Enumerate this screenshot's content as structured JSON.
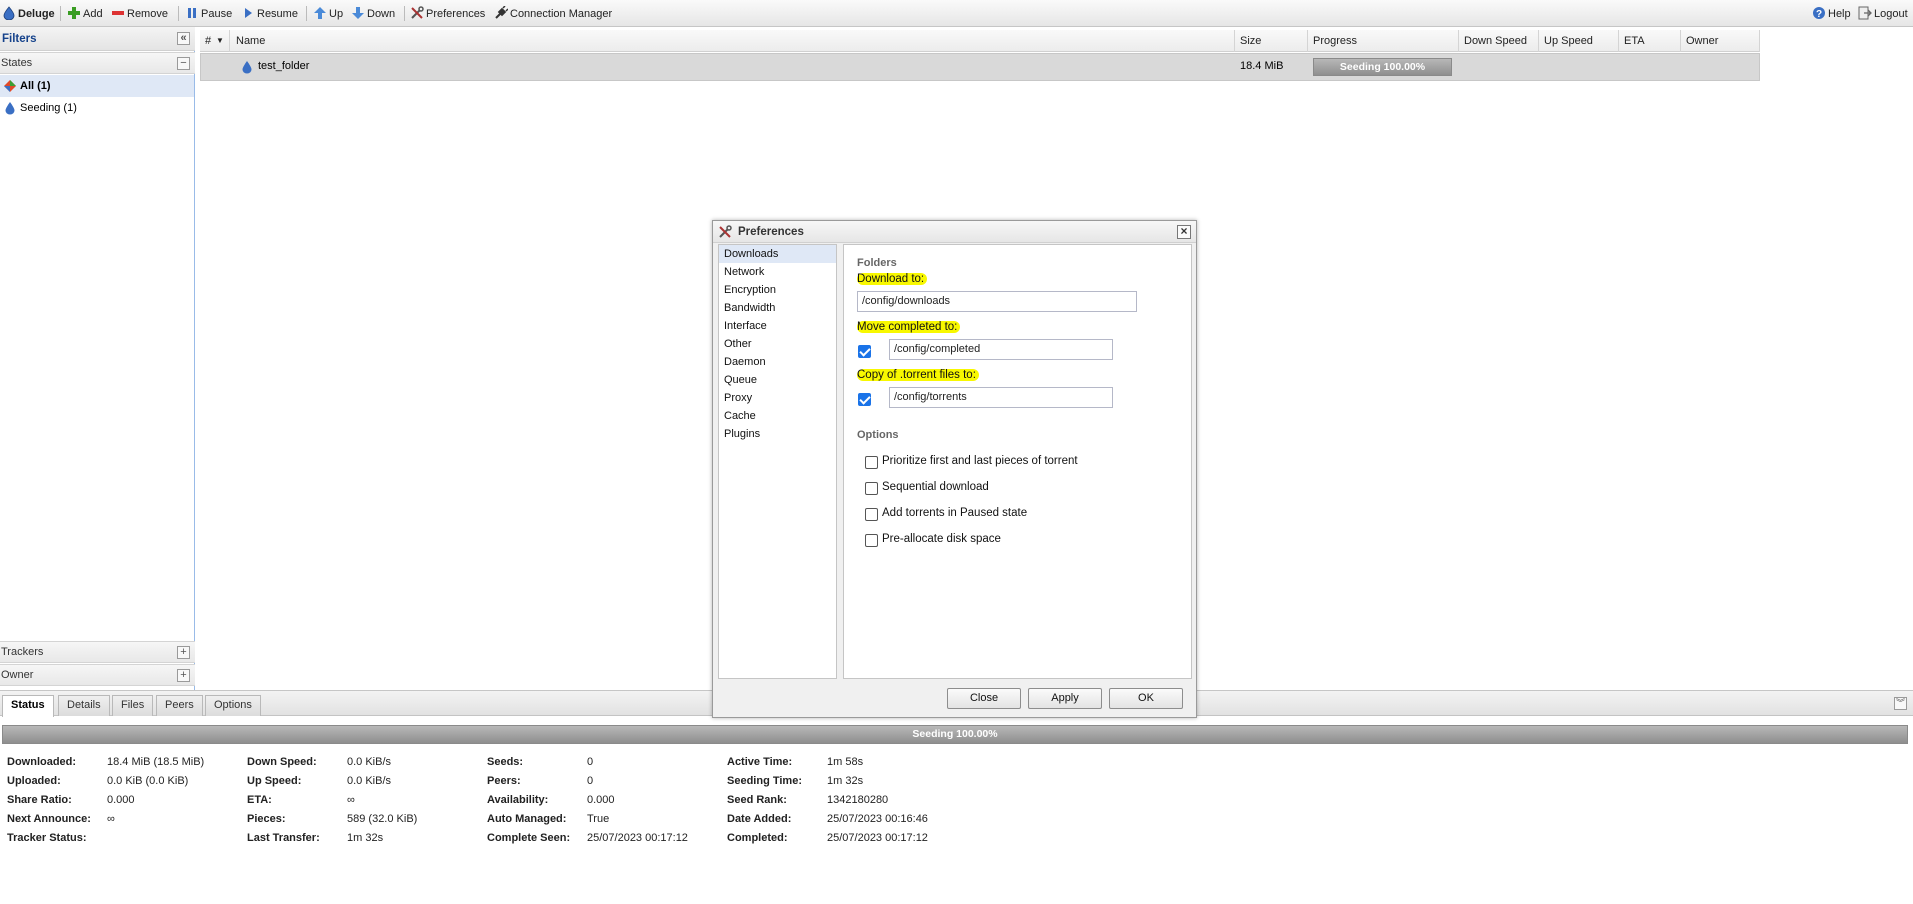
{
  "toolbar": {
    "app_title": "Deluge",
    "add": "Add",
    "remove": "Remove",
    "pause": "Pause",
    "resume": "Resume",
    "up": "Up",
    "down": "Down",
    "preferences": "Preferences",
    "connection_manager": "Connection Manager",
    "help": "Help",
    "logout": "Logout"
  },
  "filters": {
    "title": "Filters",
    "states_header": "States",
    "states": [
      {
        "label": "All (1)",
        "selected": true,
        "icon": "all-icon"
      },
      {
        "label": "Seeding (1)",
        "selected": false,
        "icon": "seeding-icon"
      }
    ],
    "trackers_header": "Trackers",
    "owner_header": "Owner"
  },
  "grid": {
    "columns": {
      "num": "#",
      "name": "Name",
      "size": "Size",
      "progress": "Progress",
      "down_speed": "Down Speed",
      "up_speed": "Up Speed",
      "eta": "ETA",
      "owner": "Owner"
    },
    "rows": [
      {
        "name": "test_folder",
        "size": "18.4 MiB",
        "progress_text": "Seeding 100.00%",
        "progress": 1.0
      }
    ]
  },
  "details": {
    "tabs": [
      "Status",
      "Details",
      "Files",
      "Peers",
      "Options"
    ],
    "active_tab": "Status",
    "progress_text": "Seeding 100.00%",
    "stats": {
      "downloaded_label": "Downloaded:",
      "downloaded": "18.4 MiB (18.5 MiB)",
      "uploaded_label": "Uploaded:",
      "uploaded": "0.0 KiB (0.0 KiB)",
      "share_ratio_label": "Share Ratio:",
      "share_ratio": "0.000",
      "next_announce_label": "Next Announce:",
      "next_announce": "∞",
      "tracker_status_label": "Tracker Status:",
      "tracker_status": "",
      "down_speed_label": "Down Speed:",
      "down_speed": "0.0 KiB/s",
      "up_speed_label": "Up Speed:",
      "up_speed": "0.0 KiB/s",
      "eta_label": "ETA:",
      "eta": "∞",
      "pieces_label": "Pieces:",
      "pieces": "589 (32.0 KiB)",
      "last_transfer_label": "Last Transfer:",
      "last_transfer": "1m 32s",
      "seeds_label": "Seeds:",
      "seeds": "0",
      "peers_label": "Peers:",
      "peers": "0",
      "availability_label": "Availability:",
      "availability": "0.000",
      "auto_managed_label": "Auto Managed:",
      "auto_managed": "True",
      "complete_seen_label": "Complete Seen:",
      "complete_seen": "25/07/2023 00:17:12",
      "active_time_label": "Active Time:",
      "active_time": "1m 58s",
      "seeding_time_label": "Seeding Time:",
      "seeding_time": "1m 32s",
      "seed_rank_label": "Seed Rank:",
      "seed_rank": "1342180280",
      "date_added_label": "Date Added:",
      "date_added": "25/07/2023 00:16:46",
      "completed_label": "Completed:",
      "completed": "25/07/2023 00:17:12"
    }
  },
  "dialog": {
    "title": "Preferences",
    "categories": [
      "Downloads",
      "Network",
      "Encryption",
      "Bandwidth",
      "Interface",
      "Other",
      "Daemon",
      "Queue",
      "Proxy",
      "Cache",
      "Plugins"
    ],
    "selected_category": "Downloads",
    "folders_title": "Folders",
    "download_to_label": "Download to:",
    "download_to_value": "/config/downloads",
    "move_completed_label": "Move completed to:",
    "move_completed_checked": true,
    "move_completed_value": "/config/completed",
    "copy_torrent_label": "Copy of .torrent files to:",
    "copy_torrent_checked": true,
    "copy_torrent_value": "/config/torrents",
    "options_title": "Options",
    "options": [
      {
        "label": "Prioritize first and last pieces of torrent",
        "checked": false
      },
      {
        "label": "Sequential download",
        "checked": false
      },
      {
        "label": "Add torrents in Paused state",
        "checked": false
      },
      {
        "label": "Pre-allocate disk space",
        "checked": false
      }
    ],
    "buttons": {
      "close": "Close",
      "apply": "Apply",
      "ok": "OK"
    }
  },
  "colors": {
    "highlight": "#f8f800",
    "selection": "#dfe8f6",
    "checkbox_checked": "#1a73e8"
  }
}
